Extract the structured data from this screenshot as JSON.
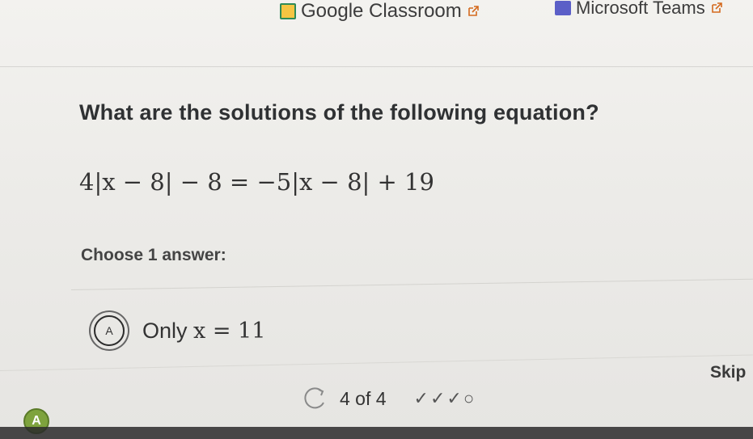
{
  "bookmarks": {
    "google_classroom": "Google Classroom",
    "microsoft_teams": "Microsoft Teams"
  },
  "question": {
    "prompt": "What are the solutions of the following equation?",
    "equation": "4|x − 8| − 8 = −5|x − 8| + 19"
  },
  "answers": {
    "choose_label": "Choose 1 answer:",
    "options": [
      {
        "letter": "A",
        "text_prefix": "Only ",
        "math": "x = 11"
      }
    ]
  },
  "footer": {
    "skip_label": "Skip",
    "counter": "4 of 4",
    "progress_marks": "✓✓✓○",
    "avatar_letter": "A"
  },
  "colors": {
    "background": "#ecebe8",
    "text": "#2f3133",
    "avatar": "#7ea33d",
    "teams": "#5b5fc7"
  }
}
